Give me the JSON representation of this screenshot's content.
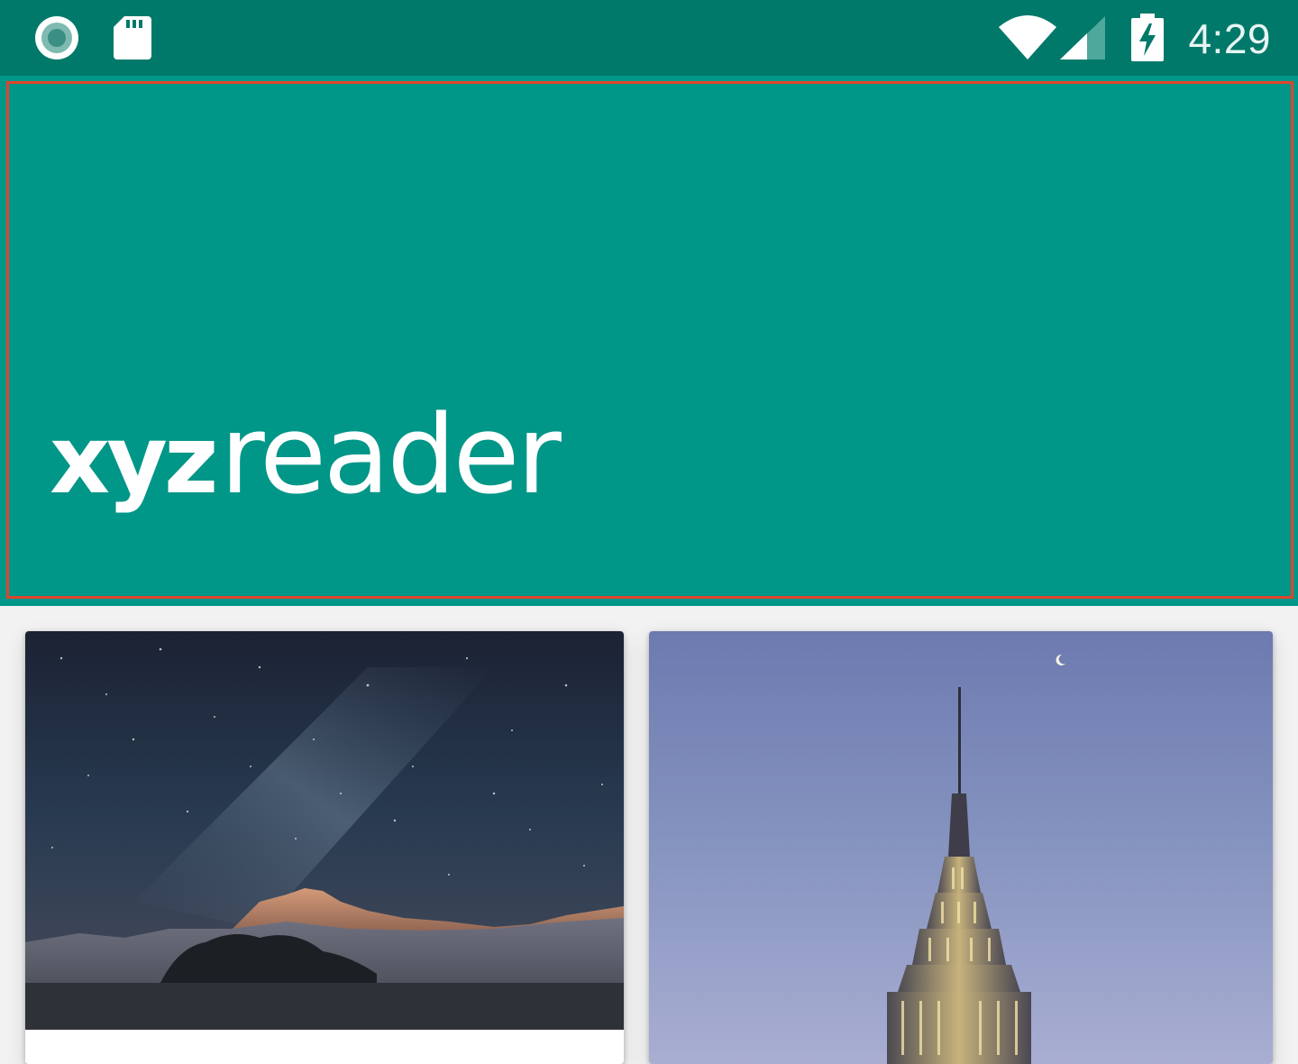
{
  "status_bar": {
    "time": "4:29",
    "left_icons": [
      "notification-circle-icon",
      "sd-card-icon"
    ],
    "right_icons": [
      "wifi-icon",
      "cell-signal-icon",
      "battery-charging-icon"
    ]
  },
  "header": {
    "logo_bold": "xyz",
    "logo_light": "reader",
    "background_color": "#009688"
  },
  "cards": [
    {
      "image": "mountain-night-sky-photo"
    },
    {
      "image": "empire-state-building-photo"
    }
  ],
  "colors": {
    "status_bar": "#00796b",
    "accent": "#009688",
    "highlight": "#e0452a"
  }
}
